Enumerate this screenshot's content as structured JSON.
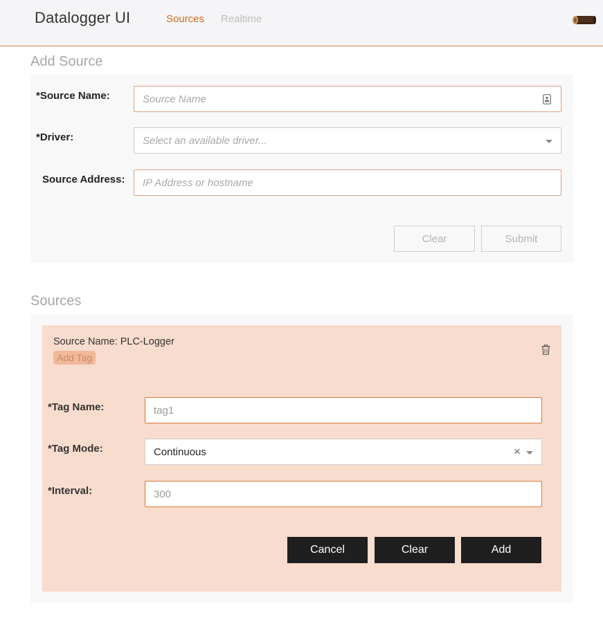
{
  "header": {
    "brand": "Datalogger UI",
    "nav": {
      "sources": "Sources",
      "realtime": "Realtime"
    },
    "logo_icon": "log-wood-icon"
  },
  "add_source": {
    "title": "Add Source",
    "source_name": {
      "label": "*Source Name:",
      "placeholder": "Source Name",
      "icon": "contact-card-icon"
    },
    "driver": {
      "label": "*Driver:",
      "placeholder": "Select an available driver..."
    },
    "source_address": {
      "label": "Source Address:",
      "placeholder": "IP Address or hostname"
    },
    "buttons": {
      "clear": "Clear",
      "submit": "Submit"
    }
  },
  "sources": {
    "title": "Sources",
    "items": [
      {
        "name_line": "Source Name: PLC-Logger",
        "add_tag": "Add Tag",
        "delete_icon": "trash-icon",
        "tag_form": {
          "tag_name": {
            "label": "*Tag Name:",
            "value": "tag1"
          },
          "tag_mode": {
            "label": "*Tag Mode:",
            "value": "Continuous",
            "clear_glyph": "×"
          },
          "interval": {
            "label": "*Interval:",
            "value": "300"
          },
          "buttons": {
            "cancel": "Cancel",
            "clear": "Clear",
            "add": "Add"
          }
        }
      }
    ]
  },
  "colors": {
    "accent": "#d2691e",
    "card_bg": "#f8dccd",
    "panel_bg": "#f8f8f8",
    "dark_button": "#1f1f1f"
  }
}
